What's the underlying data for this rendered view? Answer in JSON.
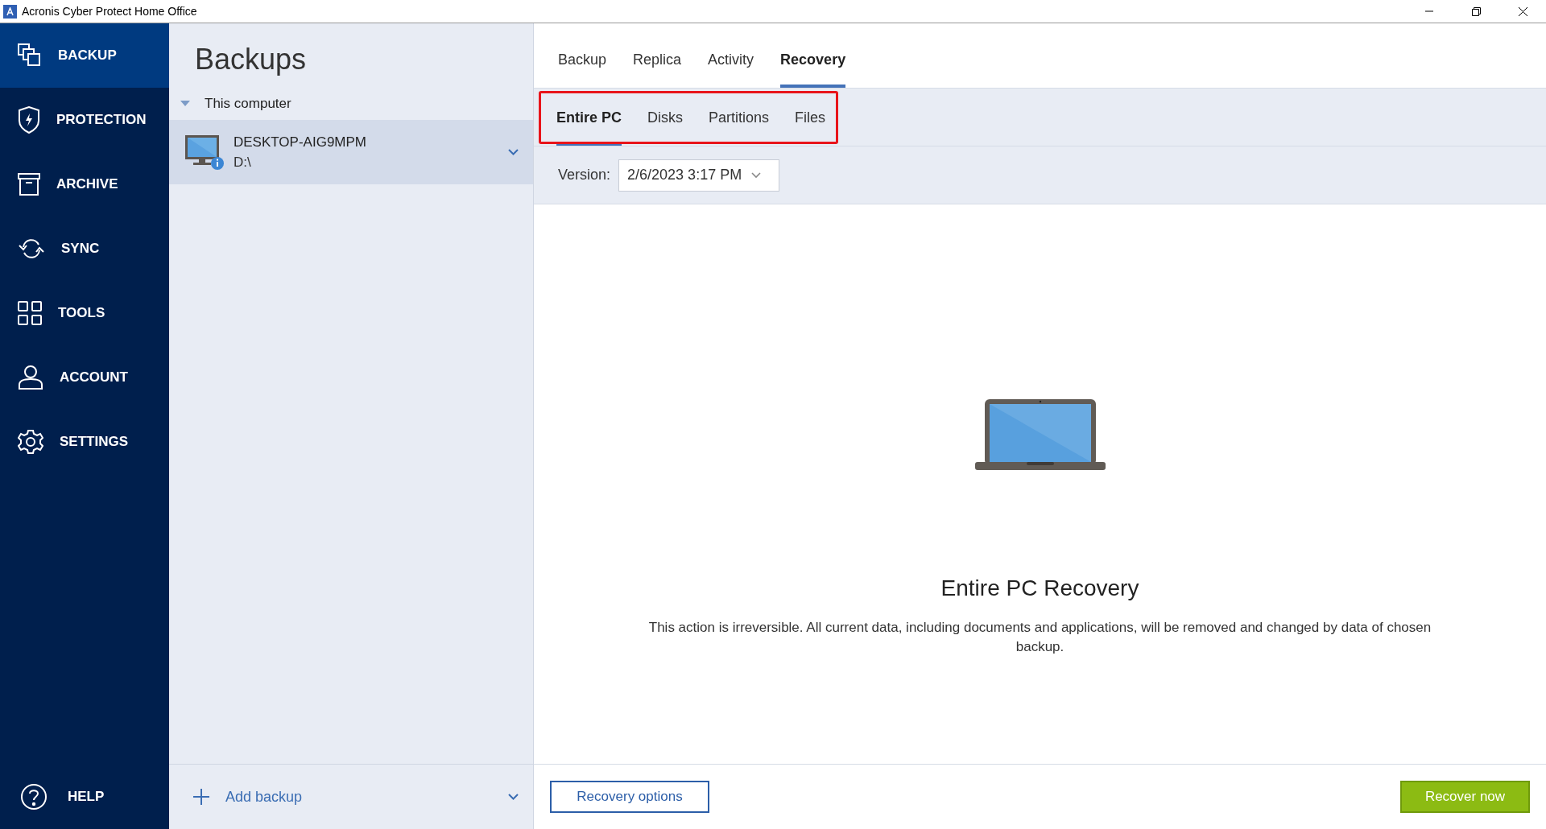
{
  "window": {
    "title": "Acronis Cyber Protect Home Office"
  },
  "sidebar": {
    "items": [
      {
        "label": "BACKUP",
        "selected": true
      },
      {
        "label": "PROTECTION",
        "selected": false
      },
      {
        "label": "ARCHIVE",
        "selected": false
      },
      {
        "label": "SYNC",
        "selected": false
      },
      {
        "label": "TOOLS",
        "selected": false
      },
      {
        "label": "ACCOUNT",
        "selected": false
      },
      {
        "label": "SETTINGS",
        "selected": false
      }
    ],
    "help": "HELP"
  },
  "backups_panel": {
    "title": "Backups",
    "group": {
      "label": "This computer",
      "expanded": true
    },
    "items": [
      {
        "name": "DESKTOP-AIG9MPM",
        "path": "D:\\",
        "selected": true
      }
    ],
    "add_backup": "Add backup"
  },
  "tabs": [
    {
      "label": "Backup",
      "selected": false
    },
    {
      "label": "Replica",
      "selected": false
    },
    {
      "label": "Activity",
      "selected": false
    },
    {
      "label": "Recovery",
      "selected": true
    }
  ],
  "subtabs": [
    {
      "label": "Entire PC",
      "selected": true
    },
    {
      "label": "Disks",
      "selected": false
    },
    {
      "label": "Partitions",
      "selected": false
    },
    {
      "label": "Files",
      "selected": false
    }
  ],
  "version": {
    "label": "Version:",
    "value": "2/6/2023 3:17 PM"
  },
  "content": {
    "title": "Entire PC Recovery",
    "description": "This action is irreversible. All current data, including documents and applications, will be removed and changed by data of chosen backup."
  },
  "buttons": {
    "options": "Recovery options",
    "recover": "Recover now"
  }
}
